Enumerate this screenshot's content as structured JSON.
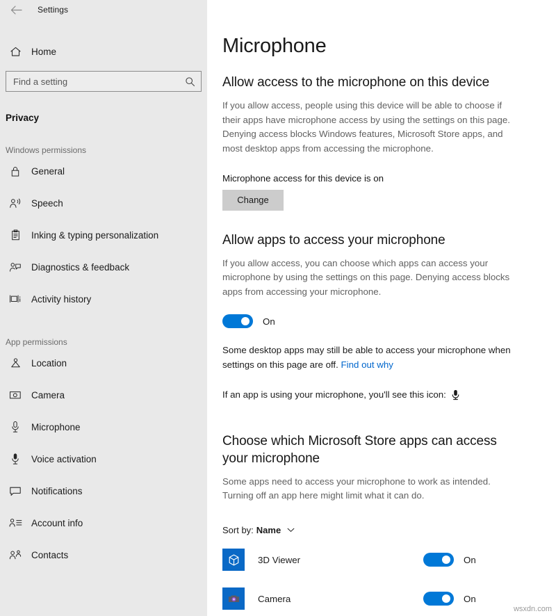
{
  "window": {
    "title": "Settings",
    "back_icon": "back-arrow-icon"
  },
  "sidebar": {
    "home_label": "Home",
    "home_icon": "home-icon",
    "search": {
      "placeholder": "Find a setting",
      "value": "",
      "icon": "search-icon"
    },
    "category_title": "Privacy",
    "groups": [
      {
        "label": "Windows permissions",
        "items": [
          {
            "label": "General",
            "icon": "lock-icon"
          },
          {
            "label": "Speech",
            "icon": "person-speaking-icon"
          },
          {
            "label": "Inking & typing personalization",
            "icon": "clipboard-icon"
          },
          {
            "label": "Diagnostics & feedback",
            "icon": "person-feedback-icon"
          },
          {
            "label": "Activity history",
            "icon": "timeline-icon"
          }
        ]
      },
      {
        "label": "App permissions",
        "items": [
          {
            "label": "Location",
            "icon": "location-pin-icon"
          },
          {
            "label": "Camera",
            "icon": "camera-icon"
          },
          {
            "label": "Microphone",
            "icon": "microphone-icon"
          },
          {
            "label": "Voice activation",
            "icon": "microphone-filled-icon"
          },
          {
            "label": "Notifications",
            "icon": "notification-bubble-icon"
          },
          {
            "label": "Account info",
            "icon": "account-info-icon"
          },
          {
            "label": "Contacts",
            "icon": "contacts-icon"
          }
        ]
      }
    ]
  },
  "main": {
    "page_title": "Microphone",
    "device_section": {
      "heading": "Allow access to the microphone on this device",
      "body": "If you allow access, people using this device will be able to choose if their apps have microphone access by using the settings on this page. Denying access blocks Windows features, Microsoft Store apps, and most desktop apps from accessing the microphone.",
      "status": "Microphone access for this device is on",
      "change_button": "Change"
    },
    "apps_section": {
      "heading": "Allow apps to access your microphone",
      "body": "If you allow access, you can choose which apps can access your microphone by using the settings on this page. Denying access blocks apps from accessing your microphone.",
      "toggle_state": "On",
      "desktop_note_before": "Some desktop apps may still be able to access your microphone when settings on this page are off.",
      "desktop_note_link": "Find out why",
      "icon_note": "If an app is using your microphone, you'll see this icon:",
      "icon_note_glyph": "microphone-filled-icon"
    },
    "store_section": {
      "heading": "Choose which Microsoft Store apps can access your microphone",
      "body": "Some apps need to access your microphone to work as intended. Turning off an app here might limit what it can do.",
      "sort_label": "Sort by:",
      "sort_value": "Name",
      "sort_chevron": "chevron-down-icon",
      "apps": [
        {
          "name": "3D Viewer",
          "state": "On",
          "icon": "cube-3d-icon",
          "tile_color": "#0a69c6"
        },
        {
          "name": "Camera",
          "state": "On",
          "icon": "camera-app-icon",
          "tile_color": "#0a69c6"
        }
      ]
    }
  },
  "watermark": "wsxdn.com",
  "colors": {
    "accent": "#0078d7",
    "link": "#0066cc",
    "sidebar_bg": "#e9e9e9",
    "button_bg": "#cccccc"
  }
}
